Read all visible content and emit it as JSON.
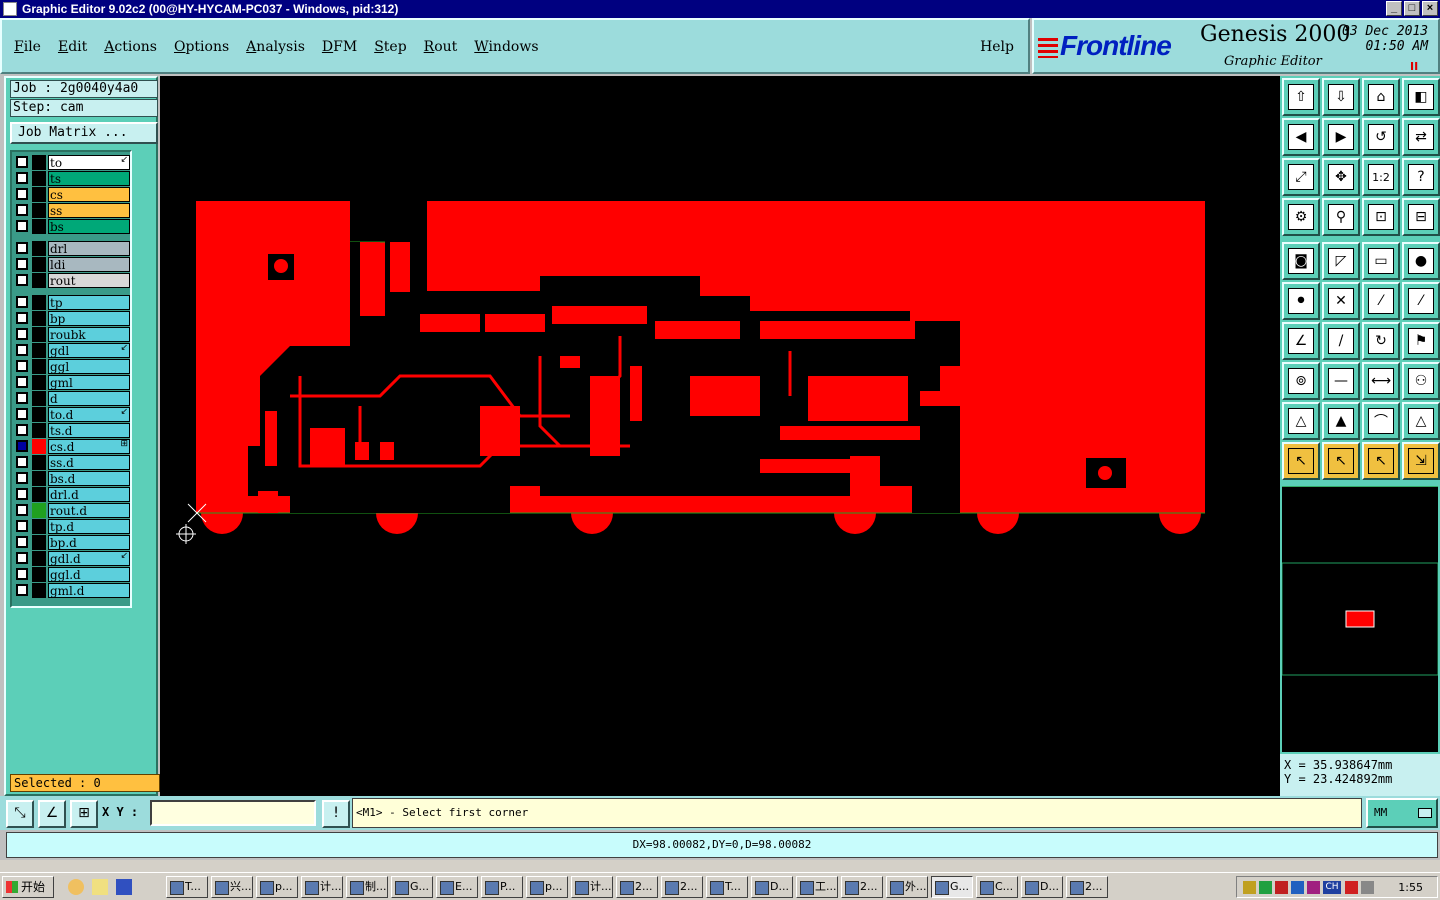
{
  "window": {
    "title": "Graphic Editor 9.02c2 (00@HY-HYCAM-PC037 - Windows, pid:312)",
    "buttons": [
      "_",
      "□",
      "×"
    ]
  },
  "menu": {
    "items": [
      "File",
      "Edit",
      "Actions",
      "Options",
      "Analysis",
      "DFM",
      "Step",
      "Rout",
      "Windows"
    ],
    "help": "Help"
  },
  "brand": {
    "logo": "Frontline",
    "product": "Genesis 2000",
    "subtitle": "Graphic Editor",
    "date": "03 Dec 2013",
    "time": "01:50 AM",
    "pause_glyph": "II"
  },
  "job": {
    "job_label": "Job : 2g0040y4a0",
    "step_label": "Step: cam",
    "matrix_button": "Job Matrix ..."
  },
  "layers": [
    {
      "name": "to",
      "color": "#ffffff",
      "mark": "↙",
      "checked": false
    },
    {
      "name": "ts",
      "color": "#00a878",
      "mark": "",
      "checked": false
    },
    {
      "name": "cs",
      "color": "#ffc040",
      "mark": "",
      "checked": false
    },
    {
      "name": "ss",
      "color": "#ffc040",
      "mark": "",
      "checked": false
    },
    {
      "name": "bs",
      "color": "#00a878",
      "mark": "",
      "checked": false
    },
    {
      "name": "drl",
      "color": "#a8b8c0",
      "mark": "",
      "checked": false
    },
    {
      "name": "ldi",
      "color": "#a8b8c0",
      "mark": "",
      "checked": false
    },
    {
      "name": "rout",
      "color": "#d8d8d8",
      "mark": "",
      "checked": false
    },
    {
      "name": "tp",
      "color": "#5ccfdc",
      "mark": "",
      "checked": false
    },
    {
      "name": "bp",
      "color": "#5ccfdc",
      "mark": "",
      "checked": false
    },
    {
      "name": "roubk",
      "color": "#5ccfdc",
      "mark": "",
      "checked": false
    },
    {
      "name": "gdl",
      "color": "#5ccfdc",
      "mark": "↙",
      "checked": false
    },
    {
      "name": "ggl",
      "color": "#5ccfdc",
      "mark": "",
      "checked": false
    },
    {
      "name": "gml",
      "color": "#5ccfdc",
      "mark": "",
      "checked": false
    },
    {
      "name": "d",
      "color": "#5ccfdc",
      "mark": "",
      "checked": false
    },
    {
      "name": "to.d",
      "color": "#5ccfdc",
      "mark": "↙",
      "checked": false
    },
    {
      "name": "ts.d",
      "color": "#5ccfdc",
      "mark": "",
      "checked": false
    },
    {
      "name": "cs.d",
      "color": "#5ccfdc",
      "mark": "⊞",
      "checked": true,
      "swatch": "#ff0000"
    },
    {
      "name": "ss.d",
      "color": "#5ccfdc",
      "mark": "",
      "checked": false
    },
    {
      "name": "bs.d",
      "color": "#5ccfdc",
      "mark": "",
      "checked": false
    },
    {
      "name": "drl.d",
      "color": "#5ccfdc",
      "mark": "",
      "checked": false
    },
    {
      "name": "rout.d",
      "color": "#5ccfdc",
      "mark": "",
      "checked": false,
      "swatch": "#20a020"
    },
    {
      "name": "tp.d",
      "color": "#5ccfdc",
      "mark": "",
      "checked": false
    },
    {
      "name": "bp.d",
      "color": "#5ccfdc",
      "mark": "",
      "checked": false
    },
    {
      "name": "gdl.d",
      "color": "#5ccfdc",
      "mark": "↙",
      "checked": false
    },
    {
      "name": "ggl.d",
      "color": "#5ccfdc",
      "mark": "",
      "checked": false
    },
    {
      "name": "gml.d",
      "color": "#5ccfdc",
      "mark": "",
      "checked": false
    }
  ],
  "selected_label": "Selected : 0",
  "canvas": {
    "background": "#000000",
    "copper_color": "#ff0000",
    "board_outline_color": "#20a020"
  },
  "toolbar_icons": [
    "open-up-icon",
    "open-down-icon",
    "home-icon",
    "split-icon",
    "left-icon",
    "right-icon",
    "back-icon",
    "refresh-icon",
    "zoom-fit-icon",
    "zoom-center-icon",
    "scale-1-2-icon",
    "help-icon",
    "tools-icon",
    "probe-icon",
    "snap-icon",
    "snap-grid-icon",
    "feature-icon",
    "pad-icon",
    "ruler-icon",
    "dot-icon",
    "net-icon",
    "cross-icon",
    "line-icon",
    "segment-icon",
    "angle-icon",
    "slash-icon",
    "arc-icon",
    "flag-icon",
    "connect-icon",
    "dash-icon",
    "dimension-icon",
    "group-icon",
    "triangle-icon",
    "peak-icon",
    "arch-icon",
    "delta-icon",
    "select-icon",
    "select-box-icon",
    "select-poly-icon",
    "select-net-icon"
  ],
  "coords": {
    "x": "X  =  35.938647mm",
    "y": "Y  =  23.424892mm"
  },
  "bottom": {
    "xy_label": "X Y :",
    "xy_value": "",
    "excl": "!",
    "prompt": "<M1> - Select first corner",
    "units": "MM",
    "measure": "DX=98.00082,DY=0,D=98.00082"
  },
  "taskbar": {
    "start": "开始",
    "tasks": [
      "T...",
      "兴...",
      "p...",
      "计...",
      "制...",
      "G...",
      "E...",
      "P...",
      "p...",
      "计...",
      "2...",
      "2...",
      "T...",
      "D...",
      "工...",
      "2...",
      "外...",
      "G...",
      "C...",
      "D...",
      "2..."
    ],
    "active_index": 17,
    "tray_text": "CH",
    "clock": "1:55"
  }
}
